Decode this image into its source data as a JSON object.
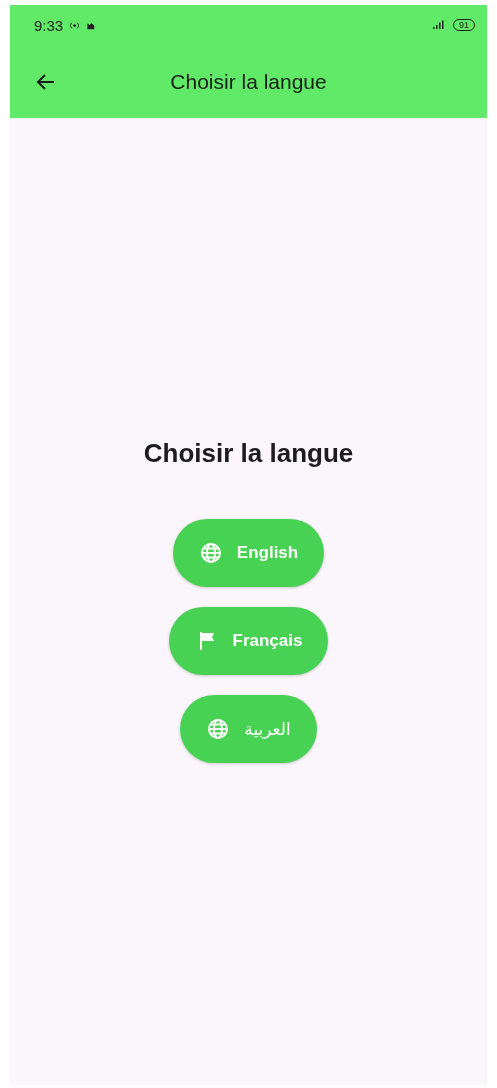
{
  "status_bar": {
    "time": "9:33",
    "battery": "91"
  },
  "app_bar": {
    "title": "Choisir la langue"
  },
  "heading": "Choisir la langue",
  "languages": [
    {
      "label": "English",
      "kind": "globe"
    },
    {
      "label": "Français",
      "kind": "flag"
    },
    {
      "label": "العربية",
      "kind": "globe"
    }
  ]
}
